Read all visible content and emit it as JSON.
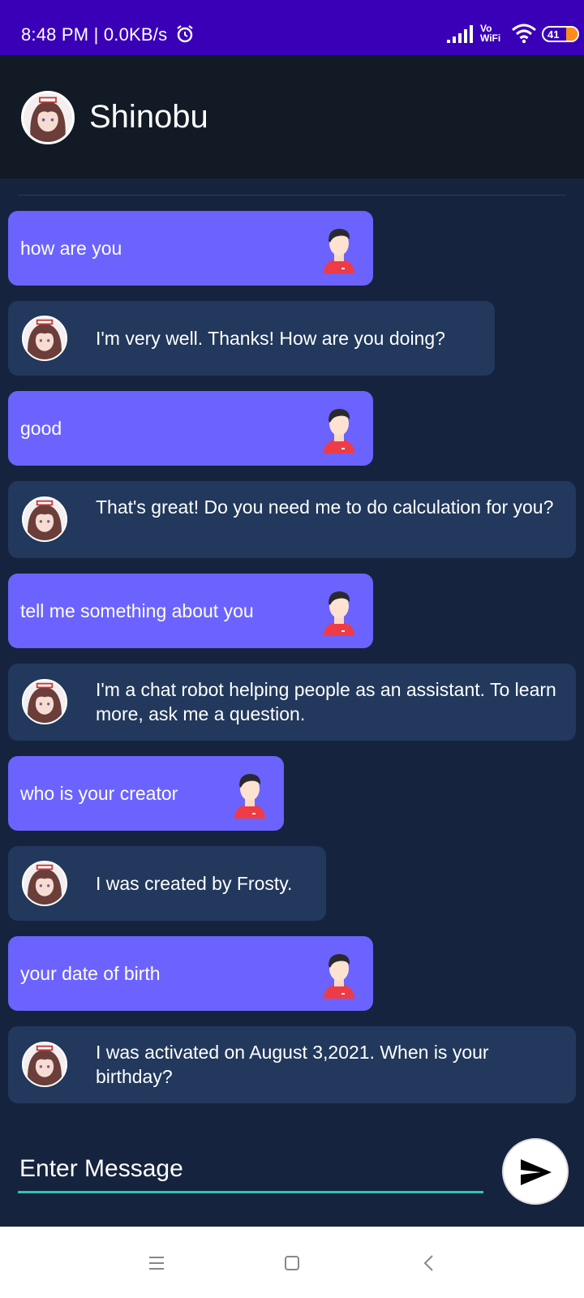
{
  "status_bar": {
    "time_speed": "8:48 PM | 0.0KB/s",
    "vowifi_top": "Vo",
    "vowifi_bottom": "WiFi",
    "battery": "41"
  },
  "app_bar": {
    "title": "Shinobu"
  },
  "messages": [
    {
      "sender": "user",
      "text": "how are you"
    },
    {
      "sender": "bot",
      "text": "I'm very well. Thanks! How are you doing?"
    },
    {
      "sender": "user",
      "text": "good"
    },
    {
      "sender": "bot",
      "text": "That's great! Do you need me to do calculation for you?"
    },
    {
      "sender": "user",
      "text": "tell me something about you"
    },
    {
      "sender": "bot",
      "text": "I'm a chat robot helping people as an assistant. To learn more, ask me a question."
    },
    {
      "sender": "user",
      "text": "who is your creator"
    },
    {
      "sender": "bot",
      "text": "I was created by Frosty."
    },
    {
      "sender": "user",
      "text": "your date of birth"
    },
    {
      "sender": "bot",
      "text": "I was activated on August 3,2021. When is your birthday?"
    }
  ],
  "input": {
    "placeholder": "Enter Message",
    "value": ""
  },
  "colors": {
    "status_bar": "#3a00b8",
    "app_bar": "#111a25",
    "background": "#16233e",
    "user_bubble": "#6c63ff",
    "bot_bubble": "#22385c",
    "input_underline": "#2fc6b0"
  },
  "icons": {
    "alarm": "alarm-icon",
    "signal": "signal-icon",
    "wifi": "wifi-icon",
    "battery": "battery-icon",
    "user_avatar": "user-avatar-icon",
    "bot_avatar": "anime-girl-avatar",
    "send": "send-icon",
    "nav_menu": "menu-icon",
    "nav_home": "home-icon",
    "nav_back": "back-icon"
  }
}
